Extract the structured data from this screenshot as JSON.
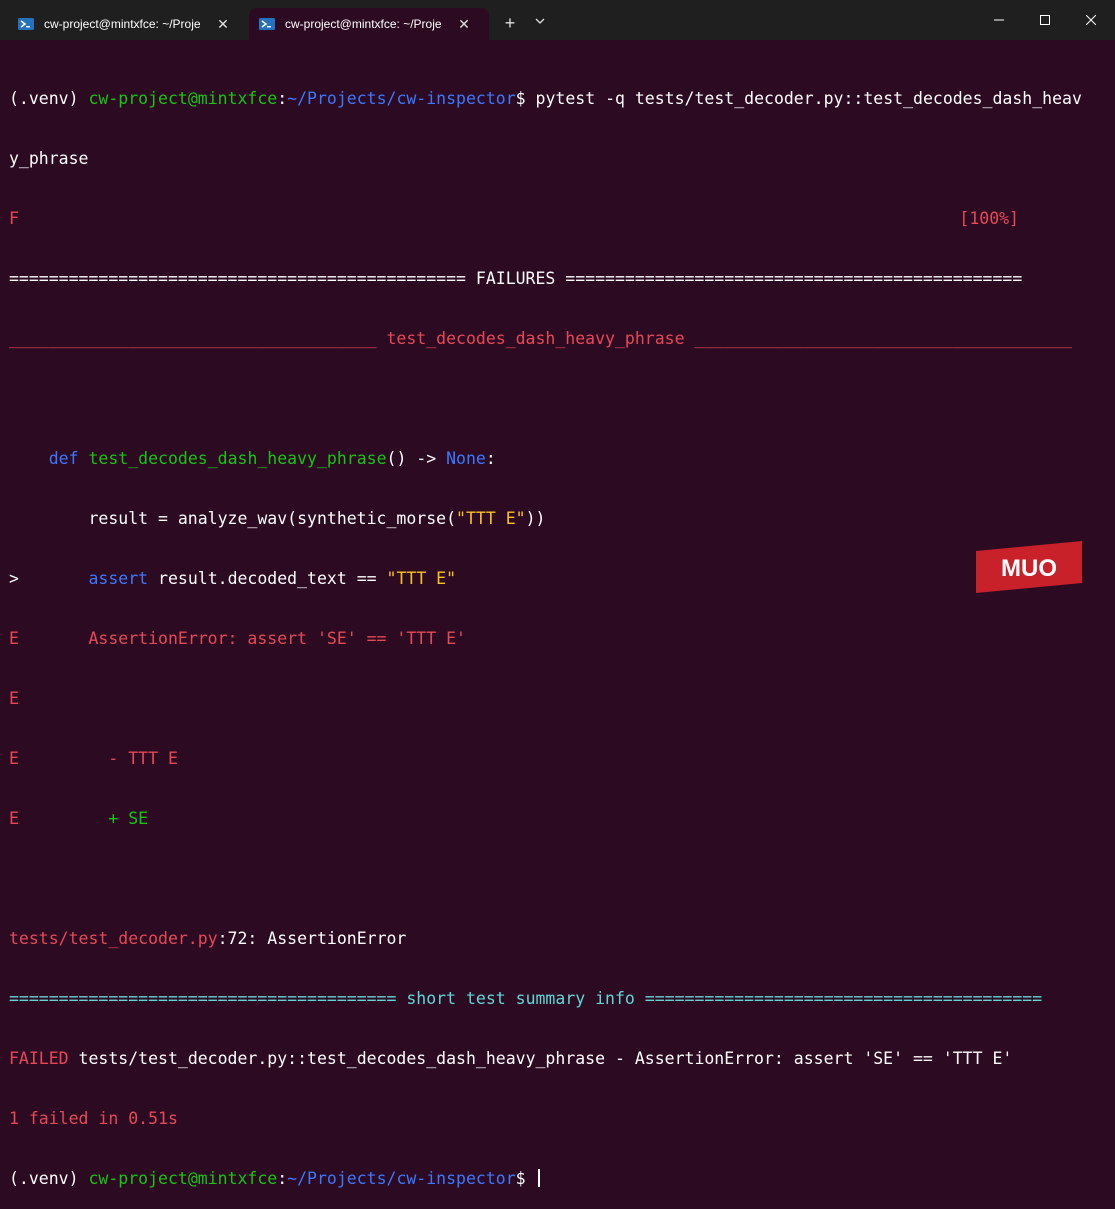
{
  "window": {
    "tabs": [
      {
        "title": "cw-project@mintxfce: ~/Proje",
        "close": "✕",
        "active": false
      },
      {
        "title": "cw-project@mintxfce: ~/Proje",
        "close": "✕",
        "active": true
      }
    ],
    "new_tab": "+",
    "dropdown": "⌵",
    "minimize": "—",
    "maximize": "☐",
    "close": "✕"
  },
  "terminal": {
    "prompt_venv": "(.venv) ",
    "prompt_user": "cw-project@mintxfce",
    "prompt_colon": ":",
    "prompt_path": "~/Projects/cw-inspector",
    "prompt_dollar": "$ ",
    "command_line1": "pytest -q tests/test_decoder.py::test_decodes_dash_heav",
    "command_line2": "y_phrase",
    "progress_char": "F",
    "progress_pct": "[100%]",
    "failures_header": "============================================== FAILURES ==============================================",
    "test_header": "_____________________________________ test_decodes_dash_heavy_phrase ______________________________________",
    "code": {
      "indent1": "    ",
      "def_kw": "def",
      "func_sig": " test_decodes_dash_heavy_phrase",
      "sig_rest": "() -> ",
      "none_kw": "None",
      "sig_colon": ":",
      "line2": "        result = analyze_wav(synthetic_morse(",
      "line2_str": "\"TTT E\"",
      "line2_end": "))",
      "marker": ">",
      "line3_pad": "       ",
      "assert_kw": "assert",
      "line3_rest": " result.decoded_text == ",
      "line3_str": "\"TTT E\"",
      "e": "E",
      "err_line": "       AssertionError: assert 'SE' == 'TTT E'",
      "minus_line": "         - TTT E",
      "plus_pad": "         ",
      "plus_line": "+ SE"
    },
    "location_file": "tests/test_decoder.py",
    "location_rest": ":72: AssertionError",
    "summary_left": "======================================= ",
    "summary_title": "short test summary info",
    "summary_right": " ========================================",
    "failed_label": "FAILED",
    "failed_rest": " tests/test_decoder.py::test_decodes_dash_heavy_phrase - AssertionError: assert 'SE' == 'TTT E'",
    "result_line": "1 failed in 0.51s"
  },
  "watermark": "MUO",
  "colors": {
    "background": "#2c0a22",
    "titlebar": "#1f1f1f",
    "green": "#16c60c",
    "blue": "#3b78ff",
    "red": "#e74856",
    "yellow": "#f9c31a",
    "cyan": "#61d6d6",
    "logo": "#c8212a"
  }
}
